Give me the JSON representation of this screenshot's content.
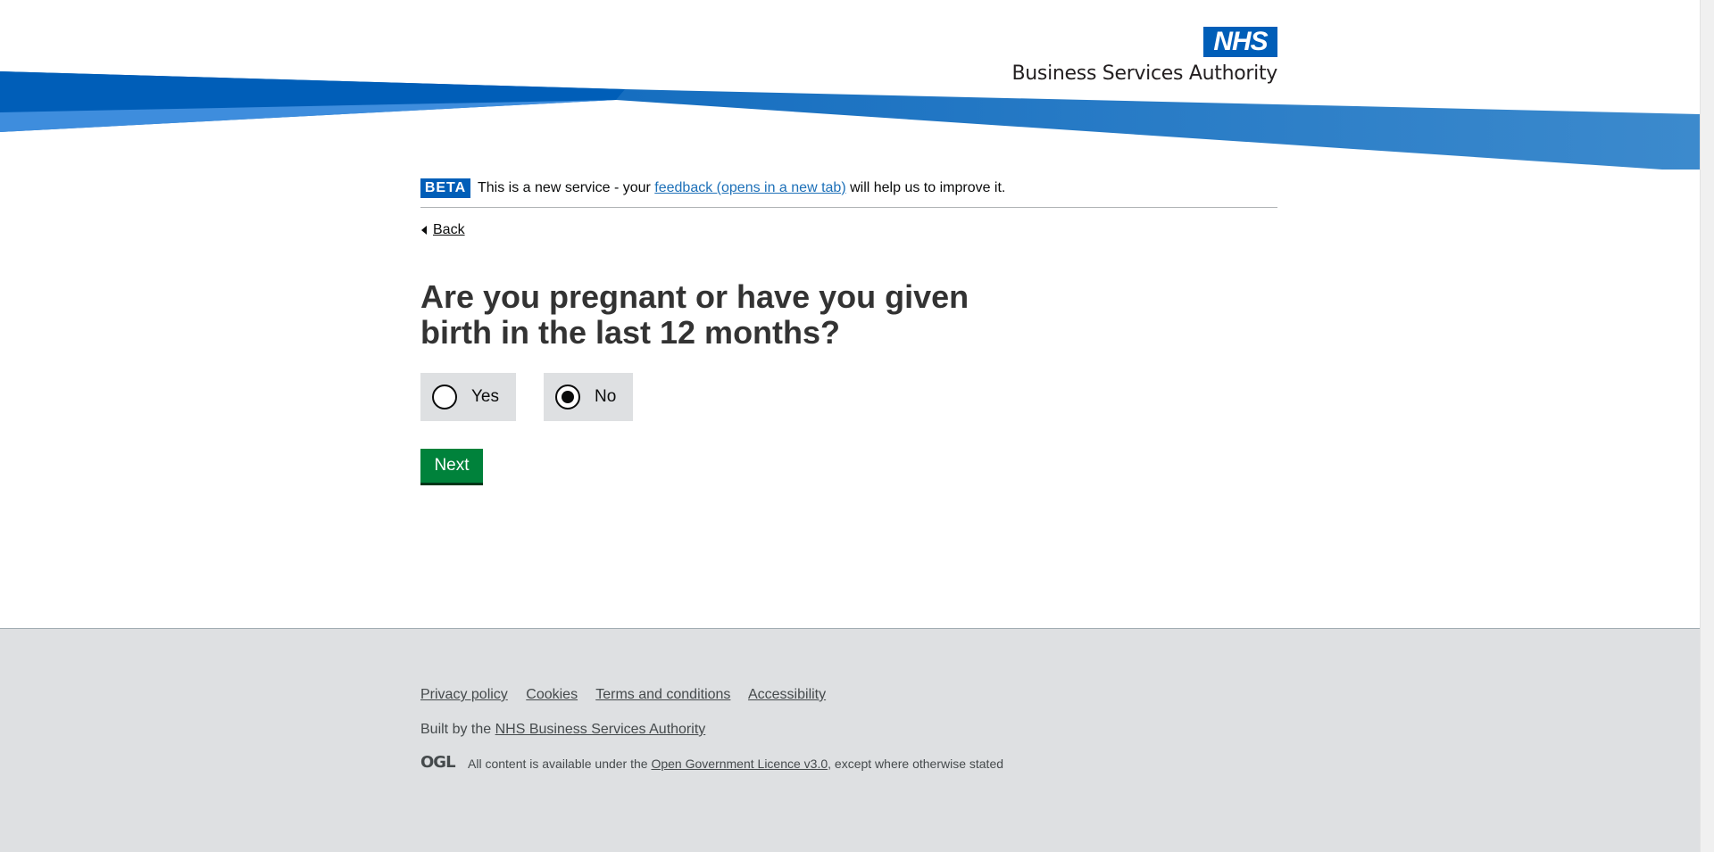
{
  "header": {
    "logo_text": "NHS",
    "org_name": "Business Services Authority",
    "brand_color": "#005eb8",
    "swoosh_colors": [
      "#005eb8",
      "#3c8acd",
      "#1d70b8"
    ]
  },
  "beta_banner": {
    "tag": "BETA",
    "text_before": "This is a new service - your ",
    "feedback_link": "feedback (opens in a new tab)",
    "text_after": " will help us to improve it."
  },
  "back_link": {
    "label": "Back",
    "icon": "chevron-left-icon"
  },
  "question": {
    "title": "Are you pregnant or have you given birth in the last 12 months?",
    "options": [
      {
        "label": "Yes",
        "selected": false
      },
      {
        "label": "No",
        "selected": true
      }
    ]
  },
  "actions": {
    "next_label": "Next",
    "button_color": "#00823b"
  },
  "footer": {
    "links": [
      "Privacy policy",
      "Cookies",
      "Terms and conditions",
      "Accessibility"
    ],
    "built_by_prefix": "Built by the ",
    "built_by_link": "NHS Business Services Authority",
    "ogl_logo": "OGL",
    "licence_prefix": "All content is available under the ",
    "licence_link": "Open Government Licence v3.0",
    "licence_suffix": ", except where otherwise stated",
    "background": "#dee0e2"
  }
}
